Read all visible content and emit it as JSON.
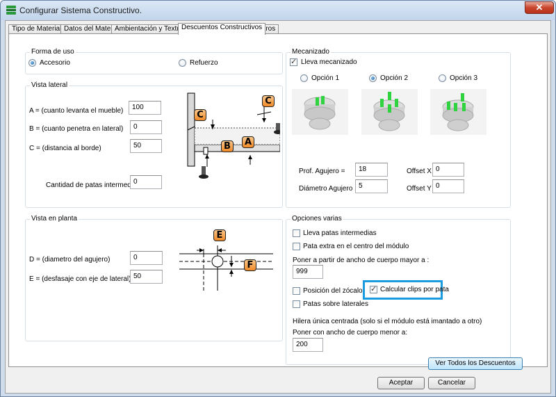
{
  "window": {
    "title": "Configurar Sistema Constructivo.",
    "close_glyph": "✕"
  },
  "tabs": [
    {
      "label": "Tipo de Material"
    },
    {
      "label": "Datos del Material"
    },
    {
      "label": "Ambientación y Texturas"
    },
    {
      "label": "Descuentos Constructivos",
      "active": true
    },
    {
      "label": "Filtros"
    }
  ],
  "forma_de_uso": {
    "title": "Forma de uso",
    "options": [
      {
        "label": "Accesorio",
        "selected": true
      },
      {
        "label": "Refuerzo",
        "selected": false
      }
    ]
  },
  "vista_lateral": {
    "title": "Vista lateral",
    "fields": [
      {
        "label": "A = (cuanto levanta el mueble)",
        "value": "100"
      },
      {
        "label": "B = (cuanto penetra en lateral)",
        "value": "0"
      },
      {
        "label": "C = (distancia al borde)",
        "value": "50"
      },
      {
        "label": "Cantidad de patas intermedias",
        "value": "0"
      }
    ],
    "diagram_badges": [
      "C",
      "C",
      "B",
      "A"
    ]
  },
  "vista_planta": {
    "title": "Vista en planta",
    "fields": [
      {
        "label": "D = (diametro del agujero)",
        "value": "0"
      },
      {
        "label": "E = (desfasaje con eje de lateral)",
        "value": "50"
      }
    ],
    "diagram_badges": [
      "E",
      "F"
    ]
  },
  "mecanizado": {
    "title": "Mecanizado",
    "lleva_mecanizado": {
      "label": "Lleva mecanizado",
      "checked": true
    },
    "options": [
      {
        "label": "Opción 1",
        "selected": false
      },
      {
        "label": "Opción 2",
        "selected": true
      },
      {
        "label": "Opción 3",
        "selected": false
      }
    ],
    "fields": [
      {
        "label": "Prof. Agujero =",
        "value": "18"
      },
      {
        "label": "Offset X",
        "value": "0"
      },
      {
        "label": "Diámetro Agujero",
        "value": "5"
      },
      {
        "label": "Offset Y",
        "value": "0"
      }
    ]
  },
  "opciones_varias": {
    "title": "Opciones varias",
    "lleva_patas": {
      "label": "Lleva patas intermedias",
      "checked": false
    },
    "pata_extra": {
      "label": "Pata extra en el centro del módulo",
      "checked": false
    },
    "poner_mayor_label": "Poner a partir de ancho de cuerpo mayor a :",
    "poner_mayor_value": "999",
    "posicion_zocalo": {
      "label": "Posición del zócalo",
      "checked": false
    },
    "calcular_clips": {
      "label": "Calcular clips por pata",
      "checked": true
    },
    "patas_laterales": {
      "label": "Patas sobre laterales",
      "checked": false
    },
    "hilera_label": "Hilera única centrada (solo si el módulo está imantado a otro)",
    "poner_menor_label": "Poner con ancho de cuerpo menor a:",
    "poner_menor_value": "200"
  },
  "buttons": {
    "ver_todos": "Ver Todos los Descuentos",
    "aceptar": "Aceptar",
    "cancelar": "Cancelar"
  },
  "colors": {
    "highlight": "#1a9be0",
    "badge": "#f08a26",
    "peg": "#2fd23f"
  }
}
